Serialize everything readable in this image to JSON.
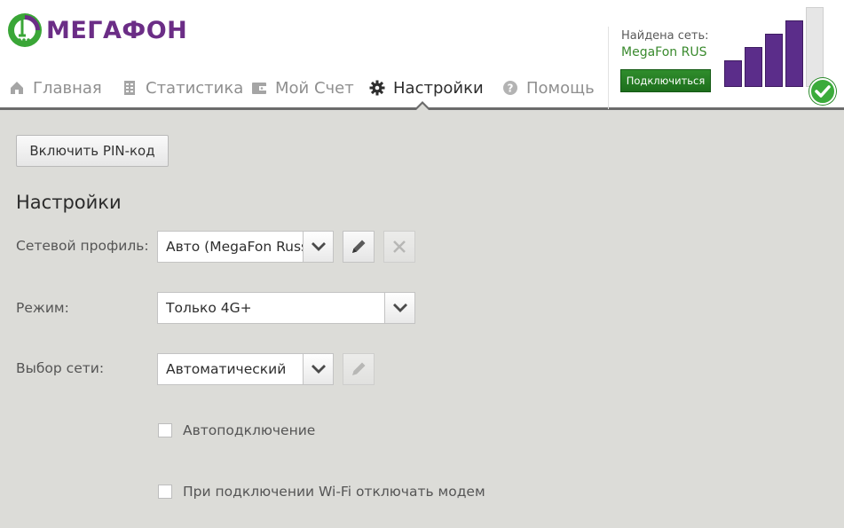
{
  "brand": {
    "name": "МЕГАФОН",
    "logo_icon": "megafon-logo-icon",
    "color": "#6b2d86"
  },
  "nav": {
    "items": [
      {
        "label": "Главная",
        "icon": "home-icon"
      },
      {
        "label": "Статистика",
        "icon": "statistics-icon"
      },
      {
        "label": "Мой Счет",
        "icon": "wallet-icon"
      },
      {
        "label": "Настройки",
        "icon": "gear-icon",
        "active": true
      },
      {
        "label": "Помощь",
        "icon": "help-icon"
      }
    ]
  },
  "network": {
    "caption": "Найдена сеть:",
    "name": "MegaFon RUS",
    "connect_label": "Подключиться",
    "signal_bars_filled": 4,
    "signal_bars_total": 5,
    "status_icon": "check-icon",
    "accent": "#5b2d8a",
    "ok_color": "#3bab3b"
  },
  "main": {
    "pin_button": "Включить PIN-код",
    "title": "Настройки",
    "profile": {
      "label": "Сетевой профиль:",
      "value": "Авто (MegaFon Russ"
    },
    "mode": {
      "label": "Режим:",
      "value": "Только 4G+"
    },
    "network_select": {
      "label": "Выбор сети:",
      "value": "Автоматический"
    },
    "auto_connect": {
      "label": "Автоподключение",
      "checked": false
    },
    "wifi_disable": {
      "label": "При подключении Wi-Fi отключать модем",
      "checked": false
    }
  }
}
